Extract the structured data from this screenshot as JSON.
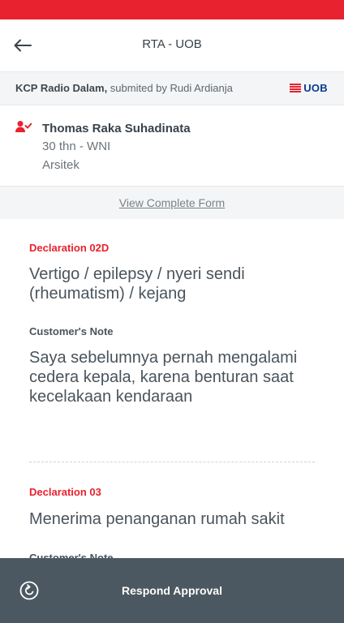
{
  "app": {
    "title": "RTA - UOB",
    "back_icon": "arrow-left-icon",
    "status_bar_color": "#e8222e",
    "accent": "#e8222e"
  },
  "submission": {
    "branch": "KCP Radio Dalam,",
    "submitted_by": " submited by Rudi Ardianja",
    "logo_text": "UOB"
  },
  "customer": {
    "icon": "user-check-icon",
    "name": "Thomas Raka Suhadinata",
    "age_nationality": "30 thn - WNI",
    "occupation": "Arsitek"
  },
  "form_link": "View Complete Form",
  "declarations": [
    {
      "label": "Declaration 02D",
      "question": "Vertigo / epilepsy / nyeri sendi (rheumatism) / kejang",
      "note_label": "Customer's Note",
      "note": "Saya sebelumnya pernah mengalami cedera kepala, karena benturan saat kecelakaan kendaraan"
    },
    {
      "label": "Declaration 03",
      "question": "Menerima penanganan rumah sakit",
      "note_label": "Customer's Note"
    }
  ],
  "bottom_action": {
    "label": "Respond Approval",
    "icon": "undo-circle-icon",
    "bar_color": "#4b5861"
  }
}
